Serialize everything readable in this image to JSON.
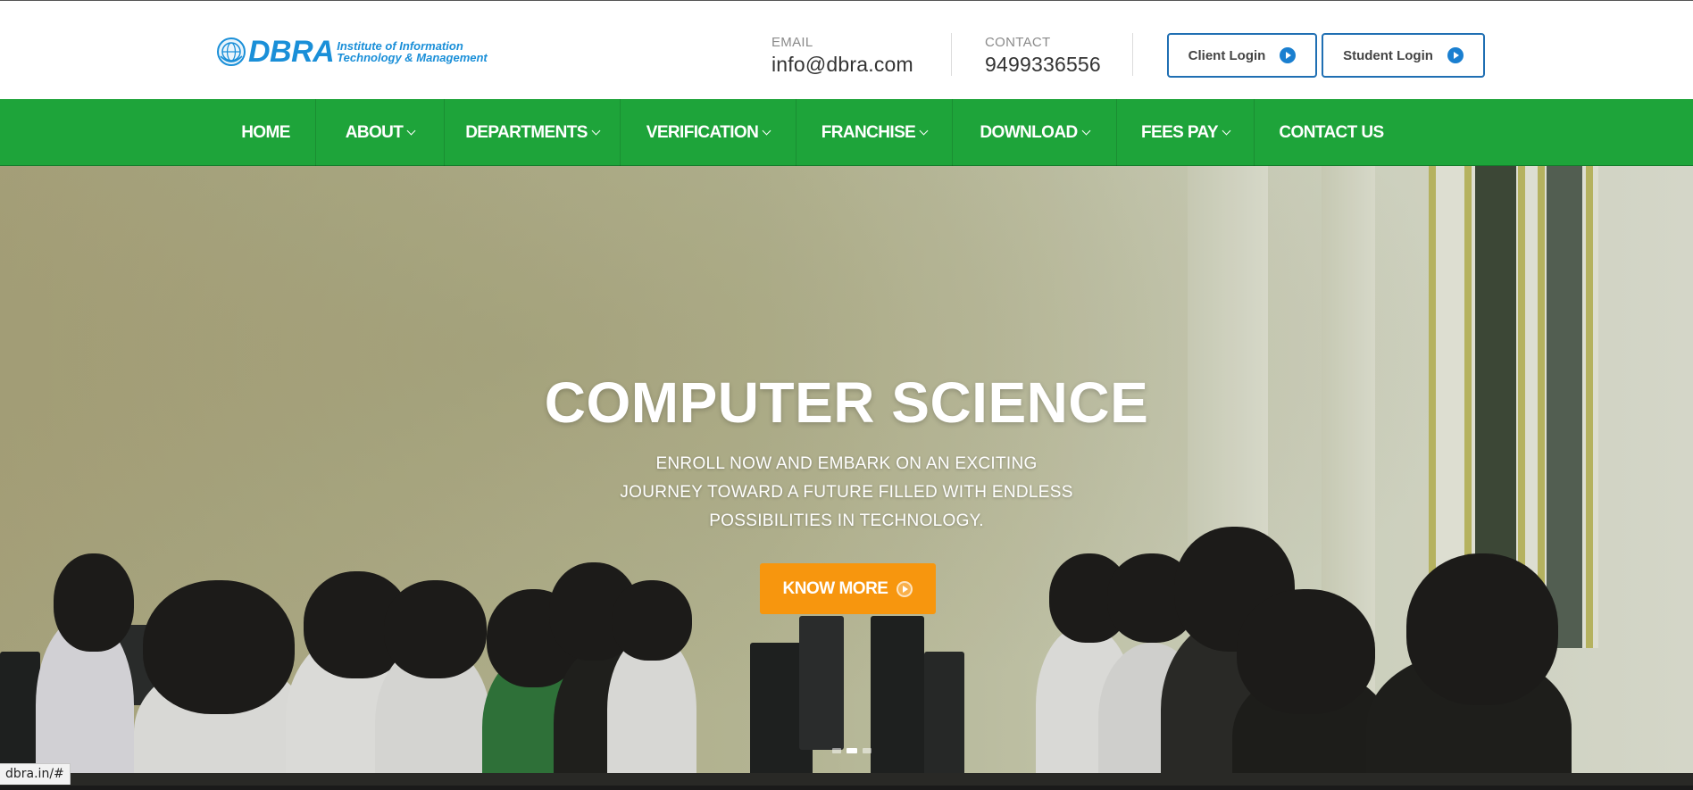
{
  "brand": {
    "name": "DBRA",
    "sub_line1": "Institute of Information",
    "sub_line2": "Technology & Management",
    "color": "#1a8fd8"
  },
  "contact": {
    "email_label": "EMAIL",
    "email_value": "info@dbra.com",
    "phone_label": "CONTACT",
    "phone_value": "9499336556"
  },
  "logins": {
    "client": "Client Login",
    "student": "Student Login"
  },
  "nav": {
    "color": "#1ea43a",
    "items": [
      {
        "label": "HOME",
        "dropdown": false
      },
      {
        "label": "ABOUT",
        "dropdown": true
      },
      {
        "label": "DEPARTMENTS",
        "dropdown": true
      },
      {
        "label": "VERIFICATION",
        "dropdown": true
      },
      {
        "label": "FRANCHISE",
        "dropdown": true
      },
      {
        "label": "DOWNLOAD",
        "dropdown": true
      },
      {
        "label": "FEES PAY",
        "dropdown": true
      },
      {
        "label": "CONTACT US",
        "dropdown": false
      }
    ]
  },
  "hero": {
    "title": "COMPUTER SCIENCE",
    "line1": "ENROLL NOW AND EMBARK ON AN EXCITING",
    "line2": "JOURNEY TOWARD A FUTURE FILLED WITH ENDLESS",
    "line3": "POSSIBILITIES IN TECHNOLOGY.",
    "button": "KNOW MORE",
    "button_color": "#f7960e",
    "slides": 3,
    "active_slide": 2
  },
  "status_bar": {
    "url": "dbra.in/#"
  }
}
